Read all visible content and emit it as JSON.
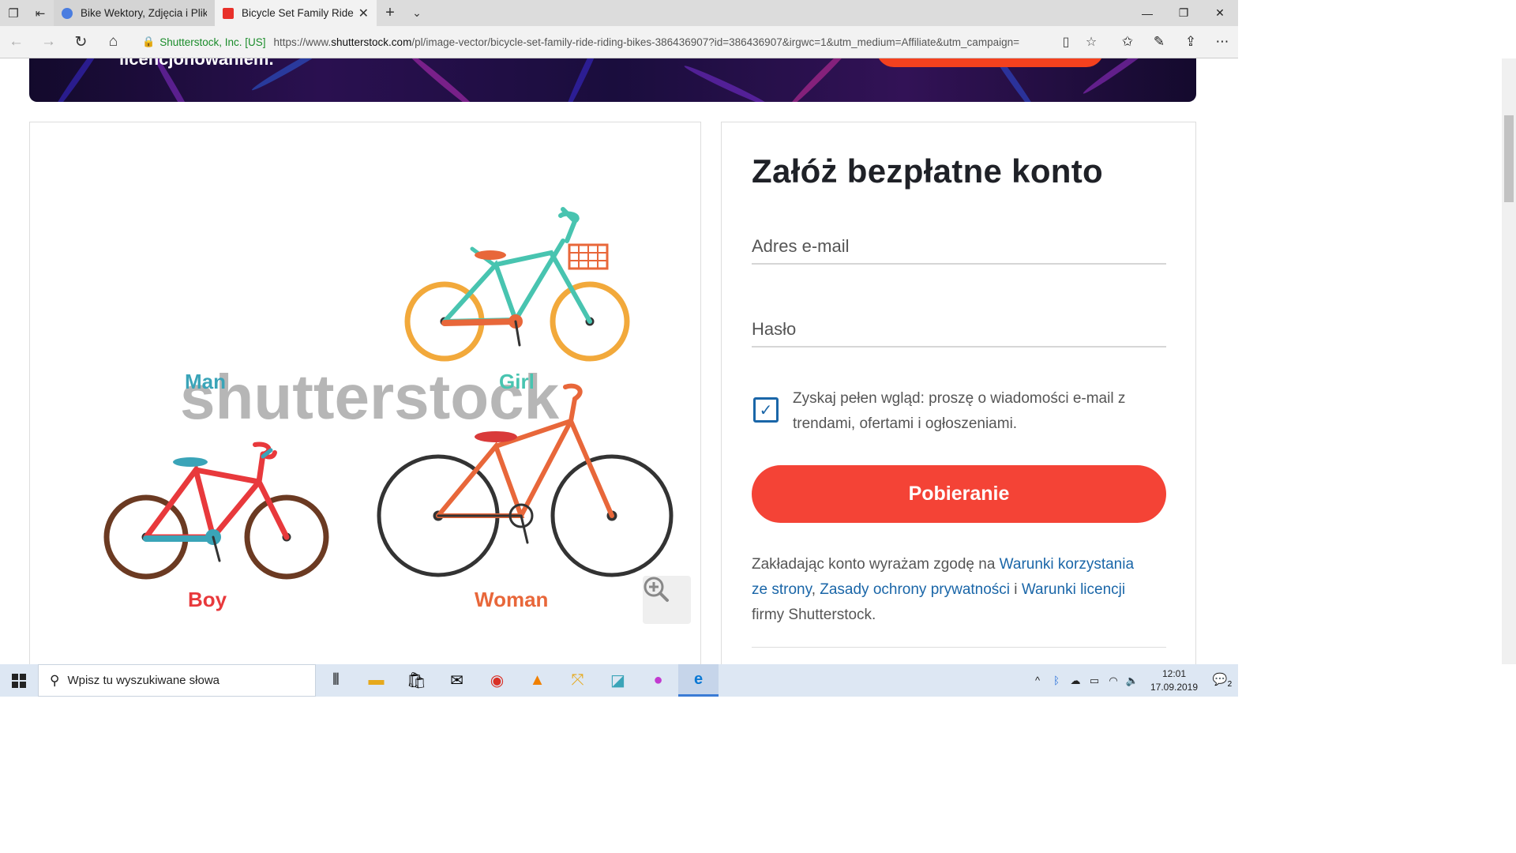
{
  "browser": {
    "tabs": [
      {
        "title": "Bike Wektory, Zdjęcia i Pliki",
        "active": false
      },
      {
        "title": "Bicycle Set Family Ride :",
        "active": true
      }
    ],
    "cert_label": "Shutterstock, Inc. [US]",
    "url_prefix": "https://www.",
    "url_domain": "shutterstock.com",
    "url_rest": "/pl/image-vector/bicycle-set-family-ride-riding-bikes-386436907?id=386436907&irgwc=1&utm_medium=Affiliate&utm_campaign="
  },
  "banner": {
    "text": "licencjonowaniem."
  },
  "image": {
    "watermark": "shutterstock",
    "labels": {
      "man": "Man",
      "girl": "Girl",
      "boy": "Boy",
      "woman": "Woman"
    },
    "colors": {
      "man": "#3aa4b8",
      "girl": "#48c4b0",
      "boy": "#e8393c",
      "woman": "#e8673a"
    }
  },
  "signup": {
    "heading": "Załóż bezpłatne konto",
    "email_placeholder": "Adres e-mail",
    "password_placeholder": "Hasło",
    "newsletter_checked": true,
    "newsletter_text": "Zyskaj pełen wgląd: proszę o wiadomości e-mail z trendami, ofertami i ogłoszeniami.",
    "download_button": "Pobieranie",
    "terms_intro": "Zakładając konto wyrażam zgodę na ",
    "terms_link1": "Warunki korzystania ze strony",
    "terms_sep1": ", ",
    "terms_link2": "Zasady ochrony prywatności",
    "terms_sep2": " i ",
    "terms_link3": "Warunki licencji",
    "terms_outro": " firmy Shutterstock.",
    "accent_color": "#f44336",
    "link_color": "#1a66a8"
  },
  "taskbar": {
    "search_placeholder": "Wpisz tu wyszukiwane słowa",
    "time": "12:01",
    "date": "17.09.2019",
    "notifications": "2"
  }
}
